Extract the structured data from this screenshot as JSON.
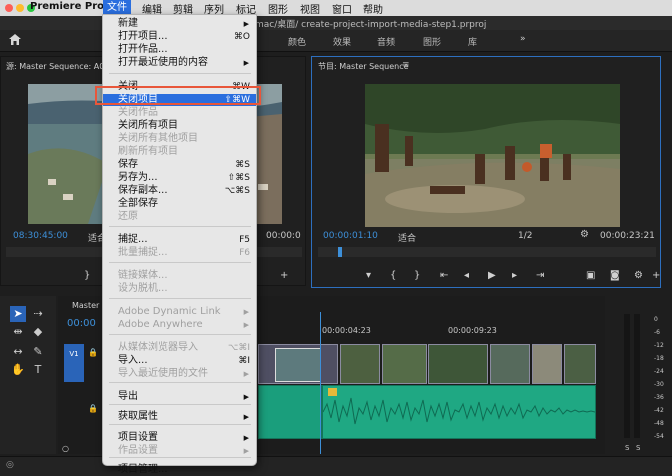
{
  "menubar": {
    "app_name": "Premiere Pro",
    "items": [
      "文件",
      "编辑",
      "剪辑",
      "序列",
      "标记",
      "图形",
      "视图",
      "窗口",
      "帮助"
    ]
  },
  "titlebar": {
    "path": "mac/桌面/  create-project-import-media-step1.prproj"
  },
  "workspaces": [
    "颜色",
    "效果",
    "音频",
    "图形",
    "库"
  ],
  "source_monitor": {
    "title": "源: Master Sequence: A002_",
    "timecode": "08:30:45:00",
    "fit": "适合",
    "duration": "00:00:0"
  },
  "program_monitor": {
    "title": "节目: Master Sequence",
    "timecode": "00:00:01:10",
    "fit": "适合",
    "quality": "1/2",
    "duration": "00:00:23:21"
  },
  "timeline": {
    "tab": "Master Se",
    "timecode": "00:00",
    "ruler": [
      "00:00:04:23",
      "00:00:09:23"
    ],
    "track_v1": "V1"
  },
  "meters": {
    "labels": [
      "0",
      "-6",
      "-12",
      "-18",
      "-24",
      "-30",
      "-36",
      "-42",
      "-48",
      "-54"
    ],
    "solo": [
      "S",
      "S"
    ]
  },
  "file_menu": {
    "items": [
      {
        "label": "新建",
        "shortcut": "",
        "arrow": true,
        "disabled": false
      },
      {
        "label": "打开项目...",
        "shortcut": "⌘O",
        "arrow": false,
        "disabled": false
      },
      {
        "label": "打开作品...",
        "shortcut": "",
        "arrow": false,
        "disabled": false
      },
      {
        "label": "打开最近使用的内容",
        "shortcut": "",
        "arrow": true,
        "disabled": false
      },
      {
        "label": "关闭",
        "shortcut": "⌘W",
        "arrow": false,
        "disabled": false
      },
      {
        "label": "关闭项目",
        "shortcut": "⇧⌘W",
        "arrow": false,
        "disabled": false,
        "highlighted": true
      },
      {
        "label": "关闭作品",
        "shortcut": "",
        "arrow": false,
        "disabled": true
      },
      {
        "label": "关闭所有项目",
        "shortcut": "",
        "arrow": false,
        "disabled": false
      },
      {
        "label": "关闭所有其他项目",
        "shortcut": "",
        "arrow": false,
        "disabled": true
      },
      {
        "label": "刷新所有项目",
        "shortcut": "",
        "arrow": false,
        "disabled": true
      },
      {
        "label": "保存",
        "shortcut": "⌘S",
        "arrow": false,
        "disabled": false
      },
      {
        "label": "另存为...",
        "shortcut": "⇧⌘S",
        "arrow": false,
        "disabled": false
      },
      {
        "label": "保存副本...",
        "shortcut": "⌥⌘S",
        "arrow": false,
        "disabled": false
      },
      {
        "label": "全部保存",
        "shortcut": "",
        "arrow": false,
        "disabled": false
      },
      {
        "label": "还原",
        "shortcut": "",
        "arrow": false,
        "disabled": true
      },
      {
        "label": "捕捉...",
        "shortcut": "F5",
        "arrow": false,
        "disabled": false
      },
      {
        "label": "批量捕捉...",
        "shortcut": "F6",
        "arrow": false,
        "disabled": true
      },
      {
        "label": "链接媒体...",
        "shortcut": "",
        "arrow": false,
        "disabled": true
      },
      {
        "label": "设为脱机...",
        "shortcut": "",
        "arrow": false,
        "disabled": true
      },
      {
        "label": "Adobe Dynamic Link",
        "shortcut": "",
        "arrow": true,
        "disabled": true
      },
      {
        "label": "Adobe Anywhere",
        "shortcut": "",
        "arrow": true,
        "disabled": true
      },
      {
        "label": "从媒体浏览器导入",
        "shortcut": "⌥⌘I",
        "arrow": false,
        "disabled": true
      },
      {
        "label": "导入...",
        "shortcut": "⌘I",
        "arrow": false,
        "disabled": false
      },
      {
        "label": "导入最近使用的文件",
        "shortcut": "",
        "arrow": true,
        "disabled": true
      },
      {
        "label": "导出",
        "shortcut": "",
        "arrow": true,
        "disabled": false
      },
      {
        "label": "获取属性",
        "shortcut": "",
        "arrow": true,
        "disabled": false
      },
      {
        "label": "项目设置",
        "shortcut": "",
        "arrow": true,
        "disabled": false
      },
      {
        "label": "作品设置",
        "shortcut": "",
        "arrow": true,
        "disabled": true
      },
      {
        "label": "项目管理...",
        "shortcut": "",
        "arrow": false,
        "disabled": false
      }
    ]
  }
}
